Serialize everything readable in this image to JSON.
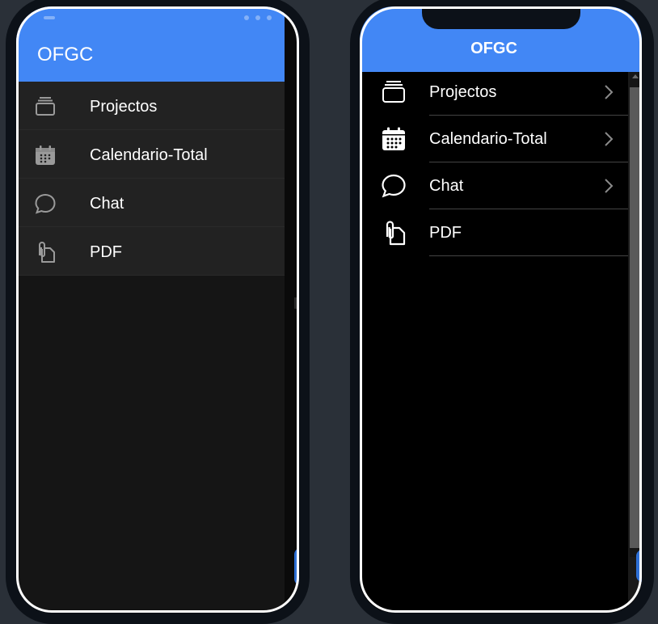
{
  "left_app": {
    "title": "OFGC",
    "menu": [
      {
        "label": "Projectos",
        "icon": "cards-stack-icon"
      },
      {
        "label": "Calendario-Total",
        "icon": "calendar-icon"
      },
      {
        "label": "Chat",
        "icon": "chat-bubble-icon"
      },
      {
        "label": "PDF",
        "icon": "document-attach-icon"
      }
    ]
  },
  "right_app": {
    "title": "OFGC",
    "menu": [
      {
        "label": "Projectos",
        "icon": "cards-stack-icon",
        "chevron": true
      },
      {
        "label": "Calendario-Total",
        "icon": "calendar-icon",
        "chevron": true
      },
      {
        "label": "Chat",
        "icon": "chat-bubble-icon",
        "chevron": true
      },
      {
        "label": "PDF",
        "icon": "document-attach-icon",
        "chevron": false
      }
    ]
  },
  "colors": {
    "header": "#4287f5",
    "android_list_bg": "#222222",
    "android_bg": "#151515",
    "ios_bg": "#000000",
    "page_bg": "#2a3038"
  }
}
